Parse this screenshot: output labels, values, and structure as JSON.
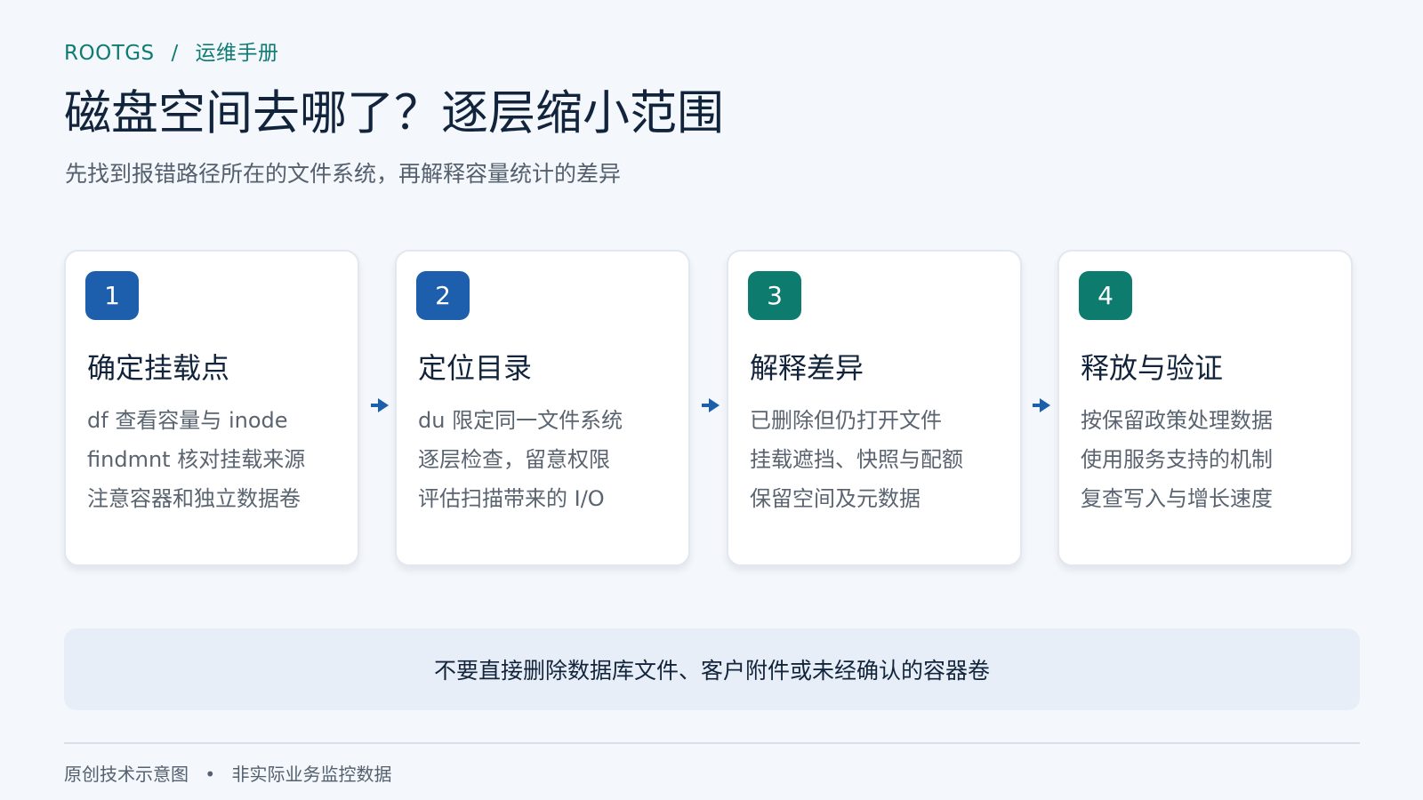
{
  "header": {
    "brand": "ROOTGS",
    "separator": "/",
    "section": "运维手册",
    "title": "磁盘空间去哪了？逐层缩小范围",
    "subtitle": "先找到报错路径所在的文件系统，再解释容量统计的差异"
  },
  "colors": {
    "accent_blue": "#1d5fac",
    "accent_green": "#0e7b6f",
    "breadcrumb": "#0f7b72",
    "card_background": "#ffffff",
    "warning_background": "#e8eef7",
    "page_background": "#f4f7fb"
  },
  "steps": [
    {
      "number": "1",
      "badge_color": "#1d5fac",
      "title": "确定挂载点",
      "lines": [
        "df 查看容量与 inode",
        "findmnt 核对挂载来源",
        "注意容器和独立数据卷"
      ]
    },
    {
      "number": "2",
      "badge_color": "#1d5fac",
      "title": "定位目录",
      "lines": [
        "du 限定同一文件系统",
        "逐层检查，留意权限",
        "评估扫描带来的 I/O"
      ]
    },
    {
      "number": "3",
      "badge_color": "#0e7b6f",
      "title": "解释差异",
      "lines": [
        "已删除但仍打开文件",
        "挂载遮挡、快照与配额",
        "保留空间及元数据"
      ]
    },
    {
      "number": "4",
      "badge_color": "#0e7b6f",
      "title": "释放与验证",
      "lines": [
        "按保留政策处理数据",
        "使用服务支持的机制",
        "复查写入与增长速度"
      ]
    }
  ],
  "connector_icon": "arrow-right-icon",
  "warning": {
    "text": "不要直接删除数据库文件、客户附件或未经确认的容器卷"
  },
  "footer": {
    "left": "原创技术示意图",
    "separator": "•",
    "right": "非实际业务监控数据"
  }
}
